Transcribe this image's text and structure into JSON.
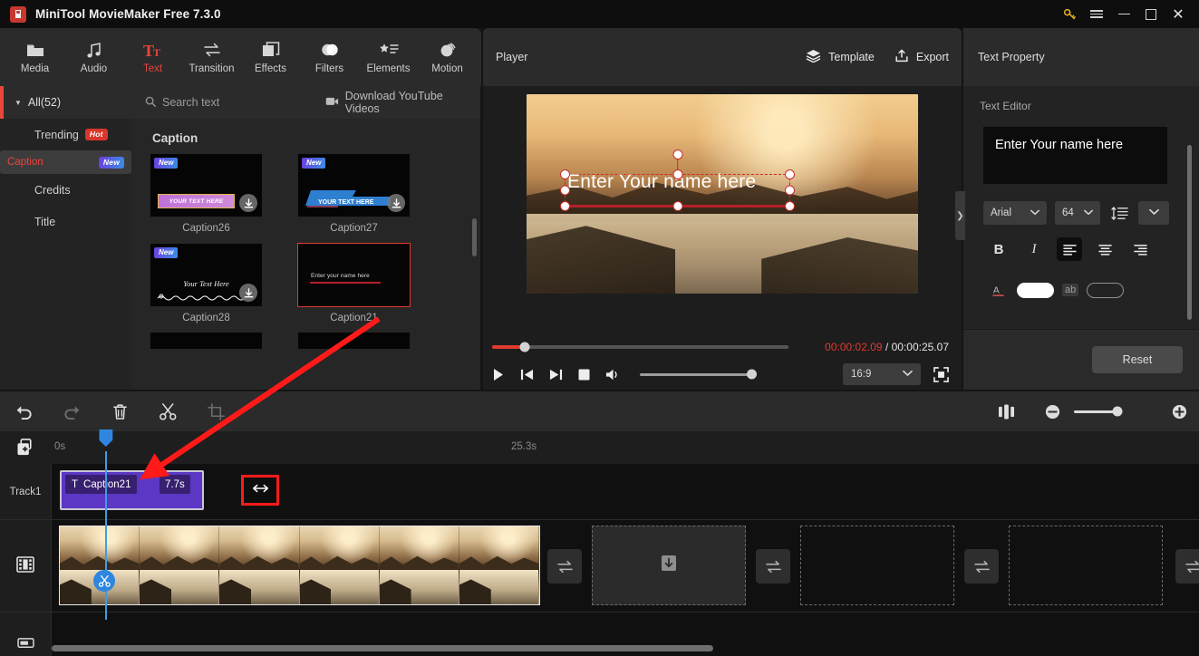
{
  "window": {
    "title": "MiniTool MovieMaker Free 7.3.0",
    "controls": {
      "key": "key-icon",
      "menu": "menu-icon",
      "minimize": "–",
      "maximize": "□",
      "close": "✕"
    }
  },
  "toolbar": {
    "items": [
      {
        "label": "Media",
        "icon": "folder-icon",
        "active": false
      },
      {
        "label": "Audio",
        "icon": "music-note-icon",
        "active": false
      },
      {
        "label": "Text",
        "icon": "text-tt-icon",
        "active": true
      },
      {
        "label": "Transition",
        "icon": "transition-arrows-icon",
        "active": false
      },
      {
        "label": "Effects",
        "icon": "effects-squares-icon",
        "active": false
      },
      {
        "label": "Filters",
        "icon": "filters-circles-icon",
        "active": false
      },
      {
        "label": "Elements",
        "icon": "elements-star-list-icon",
        "active": false
      },
      {
        "label": "Motion",
        "icon": "motion-sphere-icon",
        "active": false
      }
    ]
  },
  "sidebar": {
    "all_label": "All(52)",
    "items": [
      {
        "label": "Trending",
        "badge": "Hot",
        "badge_type": "hot",
        "selected": false
      },
      {
        "label": "Caption",
        "badge": "New",
        "badge_type": "new",
        "selected": true
      },
      {
        "label": "Credits",
        "badge": "",
        "badge_type": "",
        "selected": false
      },
      {
        "label": "Title",
        "badge": "",
        "badge_type": "",
        "selected": false
      }
    ]
  },
  "library": {
    "search_placeholder": "Search text",
    "download_label": "Download YouTube Videos",
    "section_title": "Caption",
    "items": [
      {
        "name": "Caption26",
        "badge": "New",
        "art_text": "YOUR TEXT HERE",
        "selected": false,
        "downloadable": true
      },
      {
        "name": "Caption27",
        "badge": "New",
        "art_text": "YOUR TEXT HERE",
        "selected": false,
        "downloadable": true
      },
      {
        "name": "Caption28",
        "badge": "New",
        "art_text": "Your Text Here",
        "selected": false,
        "downloadable": true
      },
      {
        "name": "Caption21",
        "badge": "",
        "art_text": "Enter your name here",
        "selected": true,
        "downloadable": false
      }
    ]
  },
  "player": {
    "title": "Player",
    "template_label": "Template",
    "export_label": "Export",
    "overlay_text": "Enter Your name here",
    "current_time": "00:00:02.09",
    "separator": " / ",
    "total_time": "00:00:25.07",
    "progress_percent": 11,
    "volume_percent": 100,
    "aspect_ratio": "16:9",
    "controls": [
      "play-icon",
      "previous-frame-icon",
      "next-frame-icon",
      "stop-icon",
      "volume-icon",
      "fullscreen-icon"
    ]
  },
  "text_property": {
    "title": "Text Property",
    "editor_label": "Text Editor",
    "editor_value": "Enter Your name here",
    "font_family": "Arial",
    "font_size": "64",
    "bold_label": "B",
    "italic_label": "I",
    "align_left": "align-left-icon",
    "align_center": "align-center-icon",
    "align_right": "align-right-icon",
    "line_spacing_icon": "line-spacing-icon",
    "text_color": "#ffffff",
    "outline_label": "ab",
    "reset_label": "Reset"
  },
  "timeline_toolbar": {
    "buttons": [
      "undo-icon",
      "redo-icon",
      "delete-icon",
      "split-scissors-icon",
      "crop-icon"
    ],
    "right_buttons": [
      "split-view-icon",
      "zoom-out-icon",
      "zoom-in-icon"
    ],
    "zoom_percent": 52
  },
  "timeline": {
    "add_track_icon": "add-media-icon",
    "ruler_start": "0s",
    "ruler_end": "25.3s",
    "tracks": [
      {
        "name": "Track1",
        "icon": "",
        "type": "text"
      },
      {
        "name": "",
        "icon": "film-strip-icon",
        "type": "video"
      },
      {
        "name": "",
        "icon": "audio-track-icon",
        "type": "audio"
      }
    ],
    "text_clip": {
      "label": "Caption21",
      "duration": "7.7s",
      "icon": "text-t-icon"
    },
    "resize_cursor_icon": "horizontal-resize-icon",
    "scissors_icon": "split-scissors-icon",
    "transition_icon": "transition-arrows-icon",
    "placeholder_icon": "download-box-icon"
  },
  "colors": {
    "accent_red": "#e8463c",
    "clip_purple": "#5b37c4",
    "playhead_blue": "#2f86e0",
    "annotation_red": "#ff1a1a"
  }
}
